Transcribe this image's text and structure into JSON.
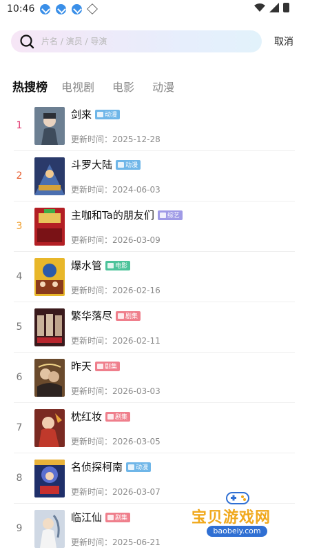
{
  "status_bar": {
    "time": "10:46",
    "left_icons": [
      "download-icon",
      "download-icon",
      "download-icon",
      "cube-icon"
    ],
    "right_icons": [
      "wifi-icon",
      "signal-icon",
      "battery-icon"
    ]
  },
  "search": {
    "placeholder": "片名 / 演员 / 导演",
    "value": "",
    "cancel_label": "取消"
  },
  "tabs": [
    {
      "label": "热搜榜",
      "active": true
    },
    {
      "label": "电视剧",
      "active": false
    },
    {
      "label": "电影",
      "active": false
    },
    {
      "label": "动漫",
      "active": false
    }
  ],
  "colors": {
    "rank_1": "#e0306a",
    "rank_2": "#e55a2a",
    "rank_3": "#f0a030",
    "rank_other": "#777777",
    "badge_anime": "#6fb6e8",
    "badge_variety": "#9f9ae6",
    "badge_movie": "#4cc39a",
    "badge_drama": "#ef7f8c"
  },
  "items": [
    {
      "rank": "1",
      "title": "剑来",
      "badge": "动漫",
      "update": "更新时间：2025-12-28"
    },
    {
      "rank": "2",
      "title": "斗罗大陆",
      "badge": "动漫",
      "update": "更新时间：2024-06-03"
    },
    {
      "rank": "3",
      "title": "主咖和Ta的朋友们",
      "badge": "综艺",
      "update": "更新时间：2026-03-09"
    },
    {
      "rank": "4",
      "title": "爆水管",
      "badge": "电影",
      "update": "更新时间：2026-02-16"
    },
    {
      "rank": "5",
      "title": "繁华落尽",
      "badge": "剧集",
      "update": "更新时间：2026-02-11"
    },
    {
      "rank": "6",
      "title": "昨天",
      "badge": "剧集",
      "update": "更新时间：2026-03-03"
    },
    {
      "rank": "7",
      "title": "枕红妆",
      "badge": "剧集",
      "update": "更新时间：2026-03-05"
    },
    {
      "rank": "8",
      "title": "名侦探柯南",
      "badge": "动漫",
      "update": "更新时间：2026-03-07"
    },
    {
      "rank": "9",
      "title": "临江仙",
      "badge": "剧集",
      "update": "更新时间：2025-06-21"
    }
  ],
  "watermark": {
    "name": "宝贝游戏网",
    "url": "baobeiy.com"
  }
}
